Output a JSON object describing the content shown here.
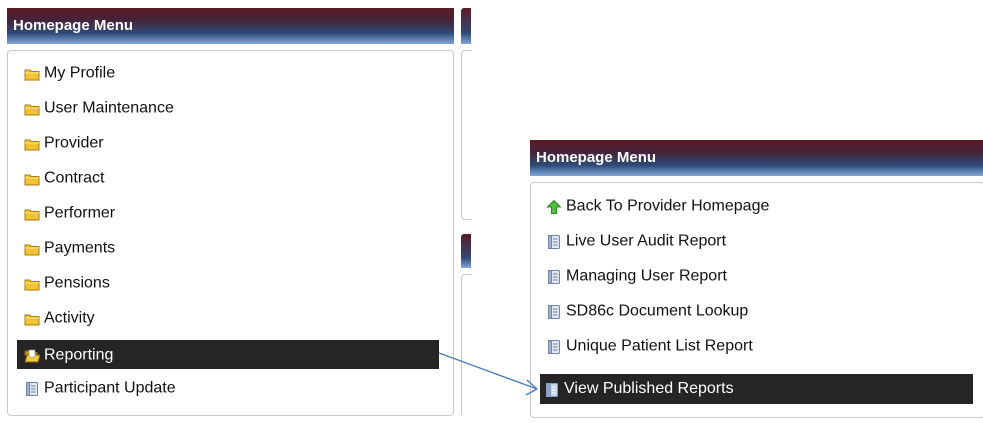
{
  "left_menu": {
    "title": "Homepage Menu",
    "items": [
      {
        "label": "My Profile",
        "icon": "folder-icon"
      },
      {
        "label": "User Maintenance",
        "icon": "folder-icon"
      },
      {
        "label": "Provider",
        "icon": "folder-icon"
      },
      {
        "label": "Contract",
        "icon": "folder-icon"
      },
      {
        "label": "Performer",
        "icon": "folder-icon"
      },
      {
        "label": "Payments",
        "icon": "folder-icon"
      },
      {
        "label": "Pensions",
        "icon": "folder-icon"
      },
      {
        "label": "Activity",
        "icon": "folder-icon"
      },
      {
        "label": "Reporting",
        "icon": "open-folder-icon",
        "selected": true
      },
      {
        "label": "Participant Update",
        "icon": "document-icon"
      }
    ]
  },
  "right_menu": {
    "title": "Homepage Menu",
    "items": [
      {
        "label": "Back To Provider Homepage",
        "icon": "green-up-arrow-icon"
      },
      {
        "label": "Live User Audit Report",
        "icon": "document-icon"
      },
      {
        "label": "Managing User Report",
        "icon": "document-icon"
      },
      {
        "label": "SD86c Document Lookup",
        "icon": "document-icon"
      },
      {
        "label": "Unique Patient List Report",
        "icon": "document-icon"
      },
      {
        "label": "View Published Reports",
        "icon": "open-document-icon",
        "selected": true
      }
    ]
  },
  "colors": {
    "header_gradient_top": "#5b1a25",
    "header_gradient_bottom": "#7fa8d8",
    "selected_bg": "#252525",
    "arrow": "#4a7fbf",
    "folder": "#f2c230"
  }
}
